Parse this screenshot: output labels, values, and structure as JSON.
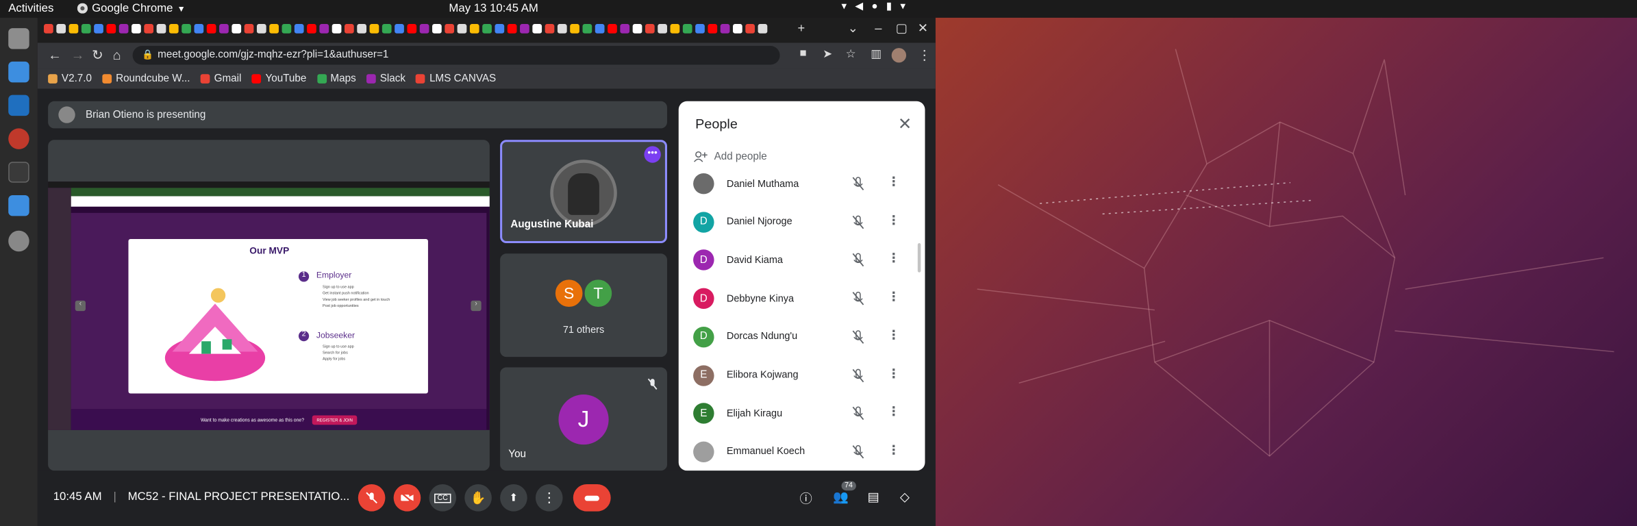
{
  "system": {
    "activities": "Activities",
    "app": "Google Chrome",
    "clock": "May 13  10:45 AM"
  },
  "browser": {
    "url": "meet.google.com/gjz-mqhz-ezr?pli=1&authuser=1",
    "bookmarks": [
      "V2.7.0",
      "Roundcube W...",
      "Gmail",
      "YouTube",
      "Maps",
      "Slack",
      "LMS CANVAS"
    ]
  },
  "meet": {
    "presenting_text": "Brian Otieno is presenting",
    "shared_slide": {
      "title": "Our MVP",
      "employer_heading": "Employer",
      "employer_items": [
        "Sign up to use app",
        "Get instant push notification",
        "View job seeker profiles and get in touch",
        "Post job opportunities"
      ],
      "jobseeker_heading": "Jobseeker",
      "jobseeker_items": [
        "Sign up to use app",
        "Search for jobs",
        "Apply for jobs"
      ],
      "footer_text": "Want to make creations as awesome as this one?",
      "footer_button": "REGISTER & JOIN"
    },
    "tiles": {
      "main_name": "Augustine Kubai",
      "others_count": "71 others",
      "others_initials": [
        "S",
        "T"
      ],
      "you_initial": "J",
      "you_label": "You"
    },
    "people_panel": {
      "title": "People",
      "add_people": "Add people",
      "participants": [
        {
          "name": "Daniel Muthama",
          "initial": "",
          "color": "#6b6b6b"
        },
        {
          "name": "Daniel Njoroge",
          "initial": "D",
          "color": "#12a4a4"
        },
        {
          "name": "David Kiama",
          "initial": "D",
          "color": "#9c27b0"
        },
        {
          "name": "Debbyne Kinya",
          "initial": "D",
          "color": "#d81b60"
        },
        {
          "name": "Dorcas Ndung'u",
          "initial": "D",
          "color": "#43a047"
        },
        {
          "name": "Elibora Kojwang",
          "initial": "E",
          "color": "#8d6e63"
        },
        {
          "name": "Elijah Kiragu",
          "initial": "E",
          "color": "#2e7d32"
        },
        {
          "name": "Emmanuel Koech",
          "initial": "",
          "color": "#9e9e9e"
        }
      ]
    },
    "controls": {
      "time": "10:45 AM",
      "meeting_name": "MC52 - FINAL PROJECT PRESENTATIO...",
      "people_count": "74"
    }
  },
  "colors": {
    "end_call": "#ea4335",
    "accent": "#8ab4f8",
    "tile_border": "#8c8cff",
    "you_avatar": "#9c27b0"
  }
}
